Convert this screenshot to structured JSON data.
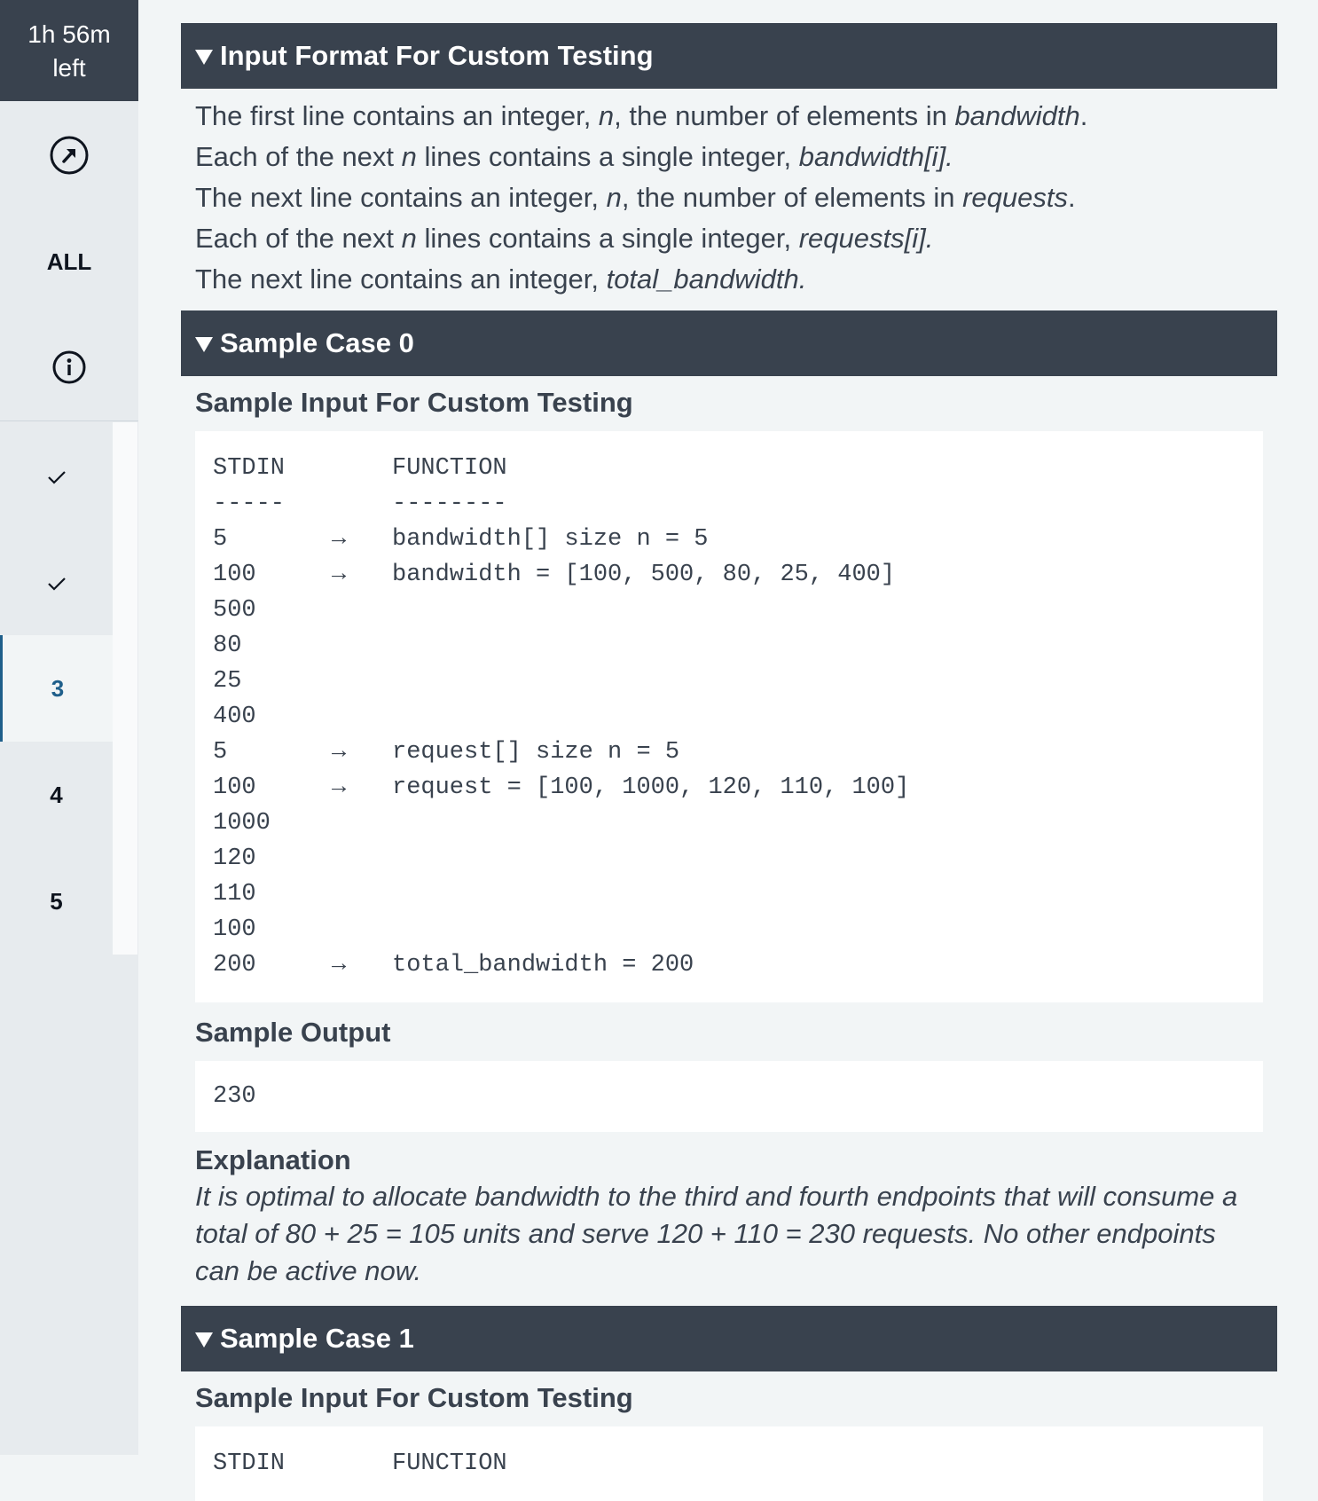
{
  "sidebar": {
    "timer_line1": "1h 56m",
    "timer_line2": "left",
    "nav_icon_1": "arrow-circle-icon",
    "all_label": "ALL",
    "info_icon": "info-icon",
    "questions": [
      {
        "label": "✓",
        "state": "done"
      },
      {
        "label": "✓",
        "state": "done"
      },
      {
        "label": "3",
        "state": "active"
      },
      {
        "label": "4",
        "state": "normal"
      },
      {
        "label": "5",
        "state": "normal"
      }
    ]
  },
  "input_format": {
    "title": "Input Format For Custom Testing",
    "lines": [
      [
        "The first line contains an integer, ",
        "n",
        ", the number of elements in ",
        "bandwidth",
        "."
      ],
      [
        "Each of the next ",
        "n",
        " lines contains a single integer, ",
        "bandwidth[i].",
        ""
      ],
      [
        "The next line contains an integer, ",
        "n",
        ", the number of elements in ",
        "requests",
        "."
      ],
      [
        "Each of the next ",
        "n",
        " lines contains a single integer, ",
        "requests[i].",
        ""
      ],
      [
        "The next line contains an integer, ",
        "total_bandwidth.",
        "",
        "",
        ""
      ]
    ]
  },
  "sample0": {
    "title": "Sample Case 0",
    "input_heading": "Sample Input For Custom Testing",
    "rows": [
      {
        "stdin": "STDIN",
        "arrow": "",
        "function": "FUNCTION"
      },
      {
        "stdin": "-----",
        "arrow": "",
        "function": "--------"
      },
      {
        "stdin": "5",
        "arrow": "→",
        "function": "bandwidth[] size n = 5"
      },
      {
        "stdin": "100",
        "arrow": "→",
        "function": "bandwidth = [100, 500, 80, 25, 400]"
      },
      {
        "stdin": "500",
        "arrow": "",
        "function": ""
      },
      {
        "stdin": "80",
        "arrow": "",
        "function": ""
      },
      {
        "stdin": "25",
        "arrow": "",
        "function": ""
      },
      {
        "stdin": "400",
        "arrow": "",
        "function": ""
      },
      {
        "stdin": "5",
        "arrow": "→",
        "function": "request[] size n = 5"
      },
      {
        "stdin": "100",
        "arrow": "→",
        "function": "request = [100, 1000, 120, 110, 100]"
      },
      {
        "stdin": "1000",
        "arrow": "",
        "function": ""
      },
      {
        "stdin": "120",
        "arrow": "",
        "function": ""
      },
      {
        "stdin": "110",
        "arrow": "",
        "function": ""
      },
      {
        "stdin": "100",
        "arrow": "",
        "function": ""
      },
      {
        "stdin": "200",
        "arrow": "→",
        "function": "total_bandwidth = 200"
      }
    ],
    "output_heading": "Sample Output",
    "output": "230",
    "explanation_heading": "Explanation",
    "explanation": "It is optimal to allocate bandwidth to the third and fourth endpoints that will consume a total of 80 + 25 = 105 units and serve 120 + 110 = 230 requests. No other endpoints can be active now."
  },
  "sample1": {
    "title": "Sample Case 1",
    "input_heading": "Sample Input For Custom Testing",
    "rows": [
      {
        "stdin": "STDIN",
        "arrow": "",
        "function": "FUNCTION"
      }
    ]
  }
}
